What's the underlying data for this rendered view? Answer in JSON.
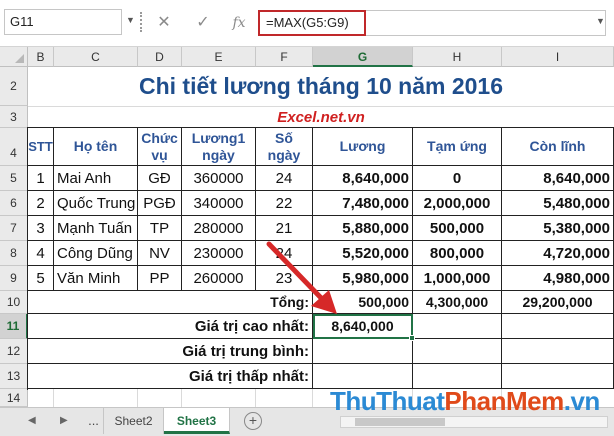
{
  "formula_bar": {
    "name_box": "G11",
    "cancel_icon": "cancel-icon",
    "enter_icon": "enter-icon",
    "fx_label": "fx",
    "formula": "=MAX(G5:G9)"
  },
  "columns": [
    "B",
    "C",
    "D",
    "E",
    "F",
    "G",
    "H",
    "I"
  ],
  "rows": [
    "2",
    "3",
    "4",
    "5",
    "6",
    "7",
    "8",
    "9",
    "10",
    "11",
    "12",
    "13",
    "14"
  ],
  "sheet": {
    "title": "Chi tiết lương tháng 10 năm 2016",
    "subtitle": "Excel.net.vn",
    "headers": {
      "stt": "STT",
      "name": "Họ tên",
      "position": "Chức vụ",
      "daily_wage": "Lương1 ngày",
      "days": "Số ngày",
      "salary": "Lương",
      "advance": "Tạm ứng",
      "remaining": "Còn lĩnh"
    },
    "data_rows": [
      {
        "stt": "1",
        "name": "Mai Anh",
        "position": "GĐ",
        "daily_wage": "360000",
        "days": "24",
        "salary": "8,640,000",
        "advance": "0",
        "remaining": "8,640,000"
      },
      {
        "stt": "2",
        "name": "Quốc Trung",
        "position": "PGĐ",
        "daily_wage": "340000",
        "days": "22",
        "salary": "7,480,000",
        "advance": "2,000,000",
        "remaining": "5,480,000"
      },
      {
        "stt": "3",
        "name": "Mạnh Tuấn",
        "position": "TP",
        "daily_wage": "280000",
        "days": "21",
        "salary": "5,880,000",
        "advance": "500,000",
        "remaining": "5,380,000"
      },
      {
        "stt": "4",
        "name": "Công Dũng",
        "position": "NV",
        "daily_wage": "230000",
        "days": "24",
        "salary": "5,520,000",
        "advance": "800,000",
        "remaining": "4,720,000"
      },
      {
        "stt": "5",
        "name": "Văn Minh",
        "position": "PP",
        "daily_wage": "260000",
        "days": "23",
        "salary": "5,980,000",
        "advance": "1,000,000",
        "remaining": "4,980,000"
      }
    ],
    "total": {
      "label": "Tổng:",
      "salary": "500,000",
      "advance": "4,300,000",
      "remaining": "29,200,000"
    },
    "max": {
      "label": "Giá trị cao nhất:",
      "value": "8,640,000"
    },
    "avg": {
      "label": "Giá trị trung bình:"
    },
    "min": {
      "label": "Giá trị thấp nhất:"
    }
  },
  "tabs": {
    "ellipsis": "...",
    "items": [
      "Sheet2",
      "Sheet3"
    ],
    "active": "Sheet3",
    "add": "+"
  },
  "watermark": {
    "part1": "ThuThuat",
    "part2": "PhanMem",
    "part3": ".vn"
  },
  "colors": {
    "accent": "#217346",
    "title": "#1f4e8c",
    "header_text": "#2f5597",
    "subtitle": "#d02020",
    "arrow": "#d62828"
  }
}
